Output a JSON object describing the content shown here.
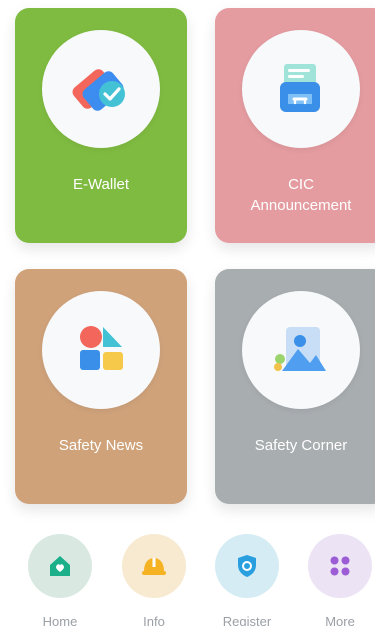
{
  "cards": [
    {
      "label": "E-Wallet",
      "icon": "wallet-icon",
      "color": "#7fbb41"
    },
    {
      "label": "CIC\nAnnouncement",
      "icon": "inbox-icon",
      "color": "#e49ca0"
    },
    {
      "label": "Safety News",
      "icon": "shapes-icon",
      "color": "#cfa27a"
    },
    {
      "label": "Safety Corner",
      "icon": "picture-icon",
      "color": "#a8adb0"
    }
  ],
  "nav": [
    {
      "label": "Home",
      "icon": "home-icon",
      "bg": "#d9e9e2"
    },
    {
      "label": "Info",
      "icon": "hardhat-icon",
      "bg": "#f7ead0"
    },
    {
      "label": "Register",
      "icon": "shield-icon",
      "bg": "#d6ecf4"
    },
    {
      "label": "More",
      "icon": "grid-dots-icon",
      "bg": "#ece3f4"
    }
  ]
}
